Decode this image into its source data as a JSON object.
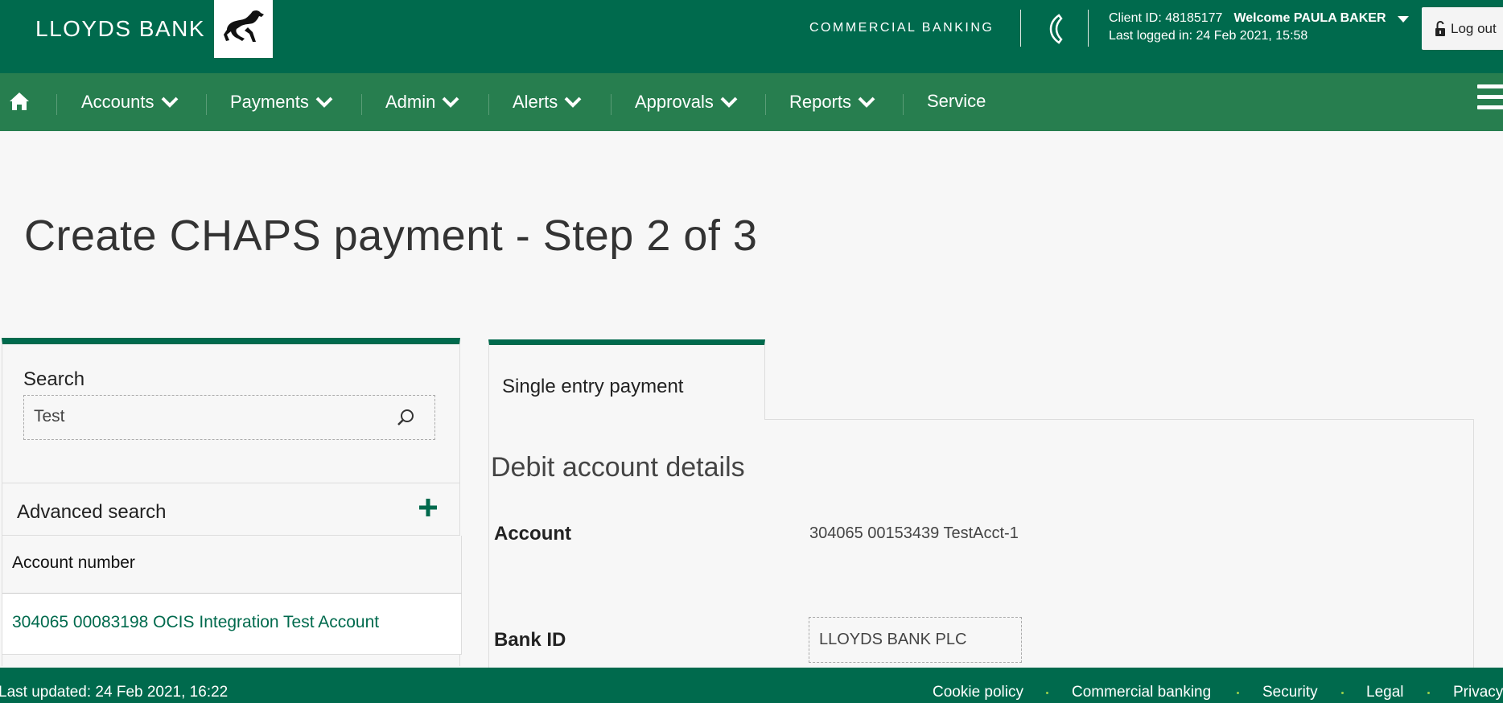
{
  "header": {
    "brand": "LLOYDS BANK",
    "section": "COMMERCIAL BANKING",
    "client_id": "Client ID: 48185177",
    "welcome": "Welcome PAULA BAKER",
    "last_logged": "Last logged in: 24 Feb 2021, 15:58",
    "logout_label": "Log out"
  },
  "nav": {
    "items": [
      {
        "label": "Accounts"
      },
      {
        "label": "Payments"
      },
      {
        "label": "Admin"
      },
      {
        "label": "Alerts"
      },
      {
        "label": "Approvals"
      },
      {
        "label": "Reports"
      },
      {
        "label": "Service"
      }
    ]
  },
  "page": {
    "title": "Create CHAPS payment - Step 2 of 3"
  },
  "search": {
    "label": "Search",
    "value": "Test",
    "advanced_label": "Advanced search",
    "results_header": "Account number",
    "results": [
      {
        "label": "304065 00083198 OCIS Integration Test Account"
      }
    ]
  },
  "payment": {
    "tab_label": "Single entry payment",
    "section_heading": "Debit account details",
    "account_label": "Account",
    "account_value": "304065 00153439 TestAcct-1",
    "bank_id_label": "Bank ID",
    "bank_id_value": "LLOYDS BANK PLC"
  },
  "footer": {
    "last_updated": "Last updated: 24 Feb 2021, 16:22",
    "links": [
      "Cookie policy",
      "Commercial banking",
      "Security",
      "Legal",
      "Privacy"
    ]
  },
  "colors": {
    "brand_green": "#006a4d",
    "nav_green": "#277e4f",
    "link_green": "#006a4d",
    "footer_dot": "#9ad14b"
  }
}
